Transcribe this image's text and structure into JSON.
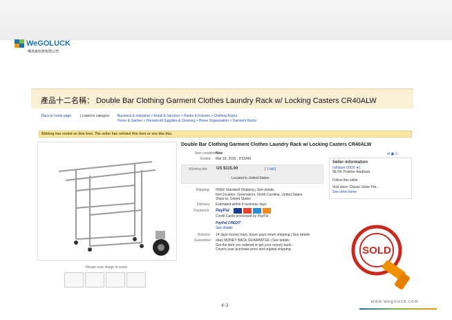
{
  "slide": {
    "heading": "產品十二名稱：  Double Bar Clothing Garment Clothes Laundry Rack w/ Locking Casters CR40ALW",
    "page_number": "4-3",
    "url": "www.wegoluck.com",
    "logo_text": "WeGOLUCK",
    "logo_sub": "唯高來科技有限公司"
  },
  "listing": {
    "back_link": "Back to home page",
    "listed_in": "| Listed in category:",
    "breadcrumb1": "Business & Industrial  >  Retail & Services  >  Racks & Fixtures  >  Clothing Racks",
    "breadcrumb2": "Home & Garden  >  Household Supplies & Cleaning  >  Home Organization  >  Garment Racks",
    "ended_banner": "Bidding has ended on this item. The seller has relisted this item or one like this.",
    "mouse_over": "Mouse over image to zoom",
    "title": "Double Bar Clothing Garment Clothes Laundry Rack w/ Locking Casters CR40ALW",
    "item_condition_label": "Item condition:",
    "item_condition": "New",
    "ended_label": "Ended:",
    "ended": "Mar 19, 2015 , 9:52AM",
    "winning_bid_label": "Winning bid:",
    "winning_bid": "US $115.00",
    "bids": "[ 1 bid ]",
    "located": "Located in United States",
    "shipping_label": "Shipping:",
    "shipping": "FREE  Standard Shipping | See details",
    "item_location": "Item location: Greensboro, North Carolina, United States",
    "ships_to": "Ships to: United States",
    "delivery_label": "Delivery:",
    "delivery": "Estimated within 6 business days",
    "payments_label": "Payments:",
    "paypal": "PayPal",
    "credit_cards": "Credit Cards processed by PayPal",
    "paypal_credit": "PayPal CREDIT",
    "see_details": "See details",
    "returns_label": "Returns:",
    "returns": "14 days money back, buyer pays return shipping | See details",
    "guarantee_label": "Guarantee:",
    "guarantee": "ebay MONEY BACK GUARANTEE | See details",
    "guarantee_sub1": "Get the item you ordered or get your money back.",
    "guarantee_sub2": "Covers your purchase price and original shipping.",
    "seller_info": "Seller information",
    "seller_name": "cxfixture (3916 ★)",
    "feedback": "96.6% Positive feedback",
    "follow": "Follow this seller",
    "visit_store": "Visit store:  Classic Store Fixt...",
    "see_other": "See other items"
  },
  "sold_stamp": "SOLD",
  "colors": {
    "link": "#1f4ea6",
    "banner": "#fbe8a6",
    "title_bg": "#fbefd6",
    "accent": "#f39200"
  }
}
